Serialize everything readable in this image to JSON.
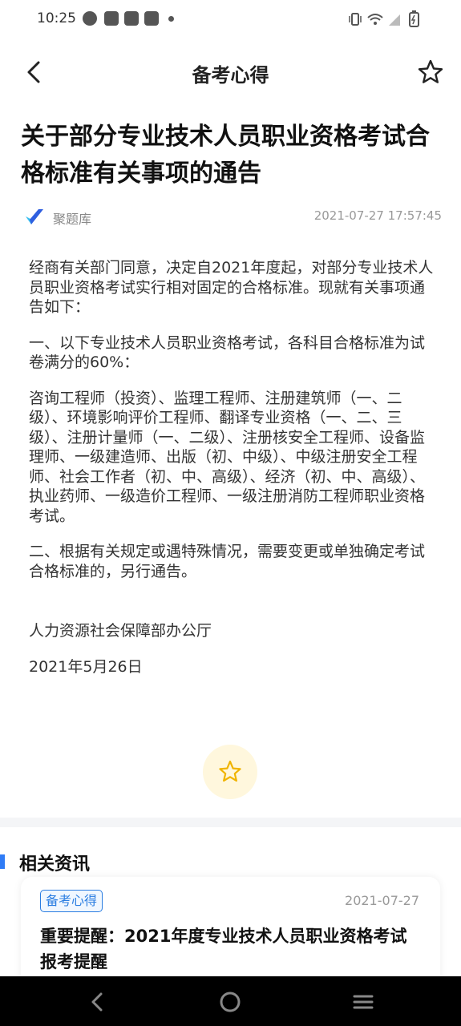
{
  "status_bar": {
    "time": "10:25"
  },
  "header": {
    "title": "备考心得"
  },
  "article": {
    "title": "关于部分专业技术人员职业资格考试合格标准有关事项的通告",
    "source": "聚题库",
    "date": "2021-07-27 17:57:45",
    "paragraphs": [
      "经商有关部门同意，决定自2021年度起，对部分专业技术人员职业资格考试实行相对固定的合格标准。现就有关事项通告如下：",
      "一、以下专业技术人员职业资格考试，各科目合格标准为试卷满分的60%：",
      "咨询工程师（投资）、监理工程师、注册建筑师（一、二级）、环境影响评价工程师、翻译专业资格（一、二、三级）、注册计量师（一、二级）、注册核安全工程师、设备监理师、一级建造师、出版（初、中级）、中级注册安全工程师、社会工作者（初、中、高级）、经济（初、中、高级）、执业药师、一级造价工程师、一级注册消防工程师职业资格考试。",
      "二、根据有关规定或遇特殊情况，需要变更或单独确定考试合格标准的，另行通告。"
    ],
    "signature": "人力资源社会保障部办公厅",
    "sign_date": "2021年5月26日"
  },
  "related": {
    "heading": "相关资讯",
    "items": [
      {
        "tag": "备考心得",
        "date": "2021-07-27",
        "title": "重要提醒：2021年度专业技术人员职业资格考试报考提醒"
      }
    ]
  },
  "icons": [
    "back-icon",
    "star-icon",
    "logo-icon",
    "nav-back-icon",
    "nav-home-icon",
    "nav-recent-icon"
  ],
  "colors": {
    "accent": "#2f7cf6",
    "tag": "#2a7de1",
    "star_bg": "#fff7dd",
    "star": "#f0b400"
  }
}
